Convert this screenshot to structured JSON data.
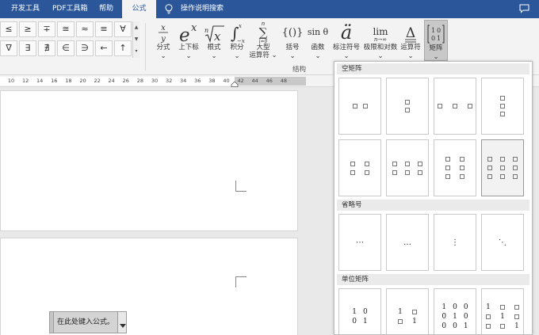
{
  "tabs": [
    {
      "label": "开发工具",
      "active": false
    },
    {
      "label": "PDF工具箱",
      "active": false
    },
    {
      "label": "帮助",
      "active": false
    },
    {
      "label": "公式",
      "active": true
    }
  ],
  "search_tab": {
    "label": "操作说明搜索",
    "icon": "lightbulb-icon"
  },
  "comment_icon": "comment-icon",
  "symbols": {
    "row1": [
      "≤",
      "≥",
      "∓",
      "≅",
      "≈",
      "≡",
      "∀"
    ],
    "row2": [
      "∇",
      "∃",
      "∄",
      "∈",
      "∋",
      "←",
      "↑"
    ]
  },
  "structures": [
    {
      "key": "fraction",
      "label": "分式",
      "glyph": "x/y"
    },
    {
      "key": "script",
      "label": "上下标",
      "glyph": "e^x"
    },
    {
      "key": "radical",
      "label": "根式",
      "glyph": "ⁿ√x"
    },
    {
      "key": "integral",
      "label": "积分",
      "glyph": "∫"
    },
    {
      "key": "large-operator",
      "label": "大型",
      "label2": "运算符",
      "glyph": "∑"
    },
    {
      "key": "bracket",
      "label": "括号",
      "glyph": "{()}"
    },
    {
      "key": "function",
      "label": "函数",
      "glyph": "sin θ"
    },
    {
      "key": "accent",
      "label": "标注符号",
      "glyph": "ä"
    },
    {
      "key": "limit-log",
      "label": "极限和对数",
      "glyph": "lim",
      "glyph_sub": "n→∞"
    },
    {
      "key": "operator",
      "label": "运算符",
      "glyph": "Δ"
    },
    {
      "key": "matrix",
      "label": "矩阵",
      "glyph": "[10 01]",
      "selected": true
    }
  ],
  "structure_group_label": "结构",
  "ruler_ticks": [
    "10",
    "12",
    "14",
    "16",
    "18",
    "20",
    "22",
    "24",
    "26",
    "28",
    "30",
    "32",
    "34",
    "36",
    "38",
    "40",
    "42",
    "44",
    "46",
    "48"
  ],
  "equation_placeholder": "在此处键入公式。",
  "matrix_gallery": {
    "empty_header": "空矩阵",
    "dots_header": "省略号",
    "identity_header": "单位矩阵",
    "dots_symbols": [
      "⋯",
      "…",
      "⋮",
      "⋱"
    ],
    "identity_2x2": [
      [
        "1",
        "0"
      ],
      [
        "0",
        "1"
      ]
    ],
    "identity_2x2_sparse": [
      [
        "1",
        ""
      ],
      [
        "",
        "1"
      ]
    ],
    "identity_3x3": [
      [
        "1",
        "0",
        "0"
      ],
      [
        "0",
        "1",
        "0"
      ],
      [
        "0",
        "0",
        "1"
      ]
    ],
    "identity_3x3_sparse": [
      [
        "1",
        "",
        ""
      ],
      [
        "",
        "1",
        ""
      ],
      [
        "",
        "",
        "1"
      ]
    ]
  }
}
